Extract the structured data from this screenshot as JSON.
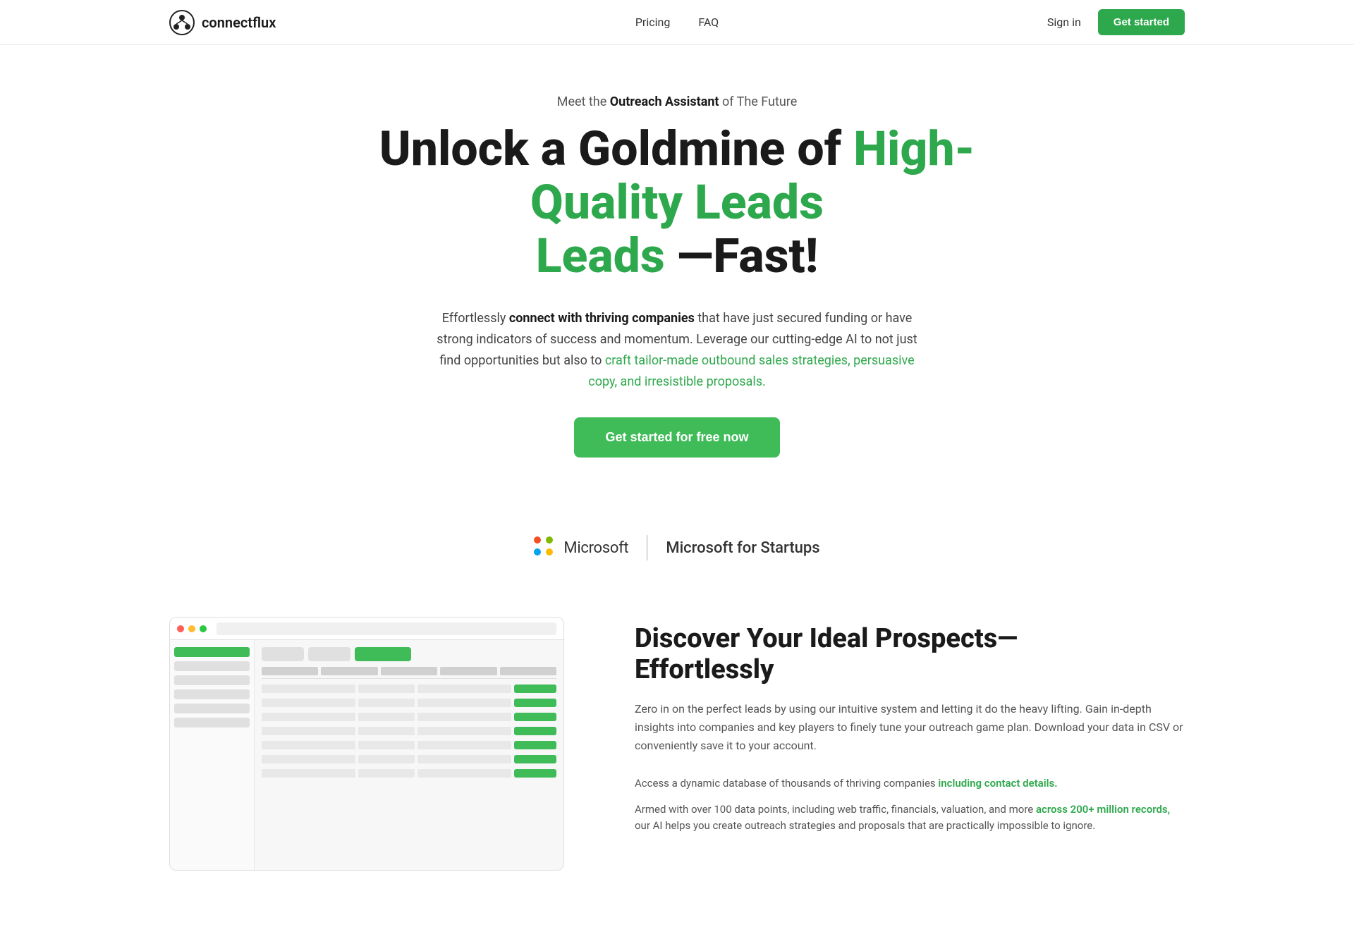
{
  "brand": {
    "name": "connectflux",
    "logo_alt": "connectflux logo"
  },
  "nav": {
    "links": [
      {
        "label": "Pricing",
        "id": "pricing"
      },
      {
        "label": "FAQ",
        "id": "faq"
      }
    ],
    "sign_in": "Sign in",
    "get_started": "Get started"
  },
  "hero": {
    "eyebrow_prefix": "Meet the ",
    "eyebrow_bold": "Outreach Assistant",
    "eyebrow_suffix": " of The Future",
    "headline_part1": "Unlock a Goldmine of ",
    "headline_green": "High-Quality Leads",
    "headline_part2": " —Fast!",
    "subtext_prefix": "Effortlessly ",
    "subtext_bold": "connect with thriving companies",
    "subtext_mid": " that have just secured funding or have strong indicators of success and momentum. Leverage our cutting-edge AI to not just find opportunities but also to ",
    "subtext_green": "craft tailor-made outbound sales strategies, persuasive copy, and irresistible proposals.",
    "cta_label": "Get started for free now"
  },
  "microsoft": {
    "logo_text": "Microsoft",
    "tagline": "Microsoft for Startups"
  },
  "discover": {
    "title_line1": "Discover Your Ideal Prospects—",
    "title_line2": "Effortlessly",
    "description": "Zero in on the perfect leads by using our intuitive system and letting it do the heavy lifting. Gain in-depth insights into companies and key players to finely tune your outreach game plan. Download your data in CSV or conveniently save it to your account.",
    "bullets": [
      {
        "prefix": "Access a dynamic database of thousands of thriving companies ",
        "link": "including contact details.",
        "suffix": ""
      },
      {
        "prefix": "Armed with over 100 data points, including web traffic, financials, valuation, and more ",
        "link": "across 200+ million records,",
        "suffix": " our AI helps you create outreach strategies and proposals that are practically impossible to ignore."
      }
    ]
  }
}
